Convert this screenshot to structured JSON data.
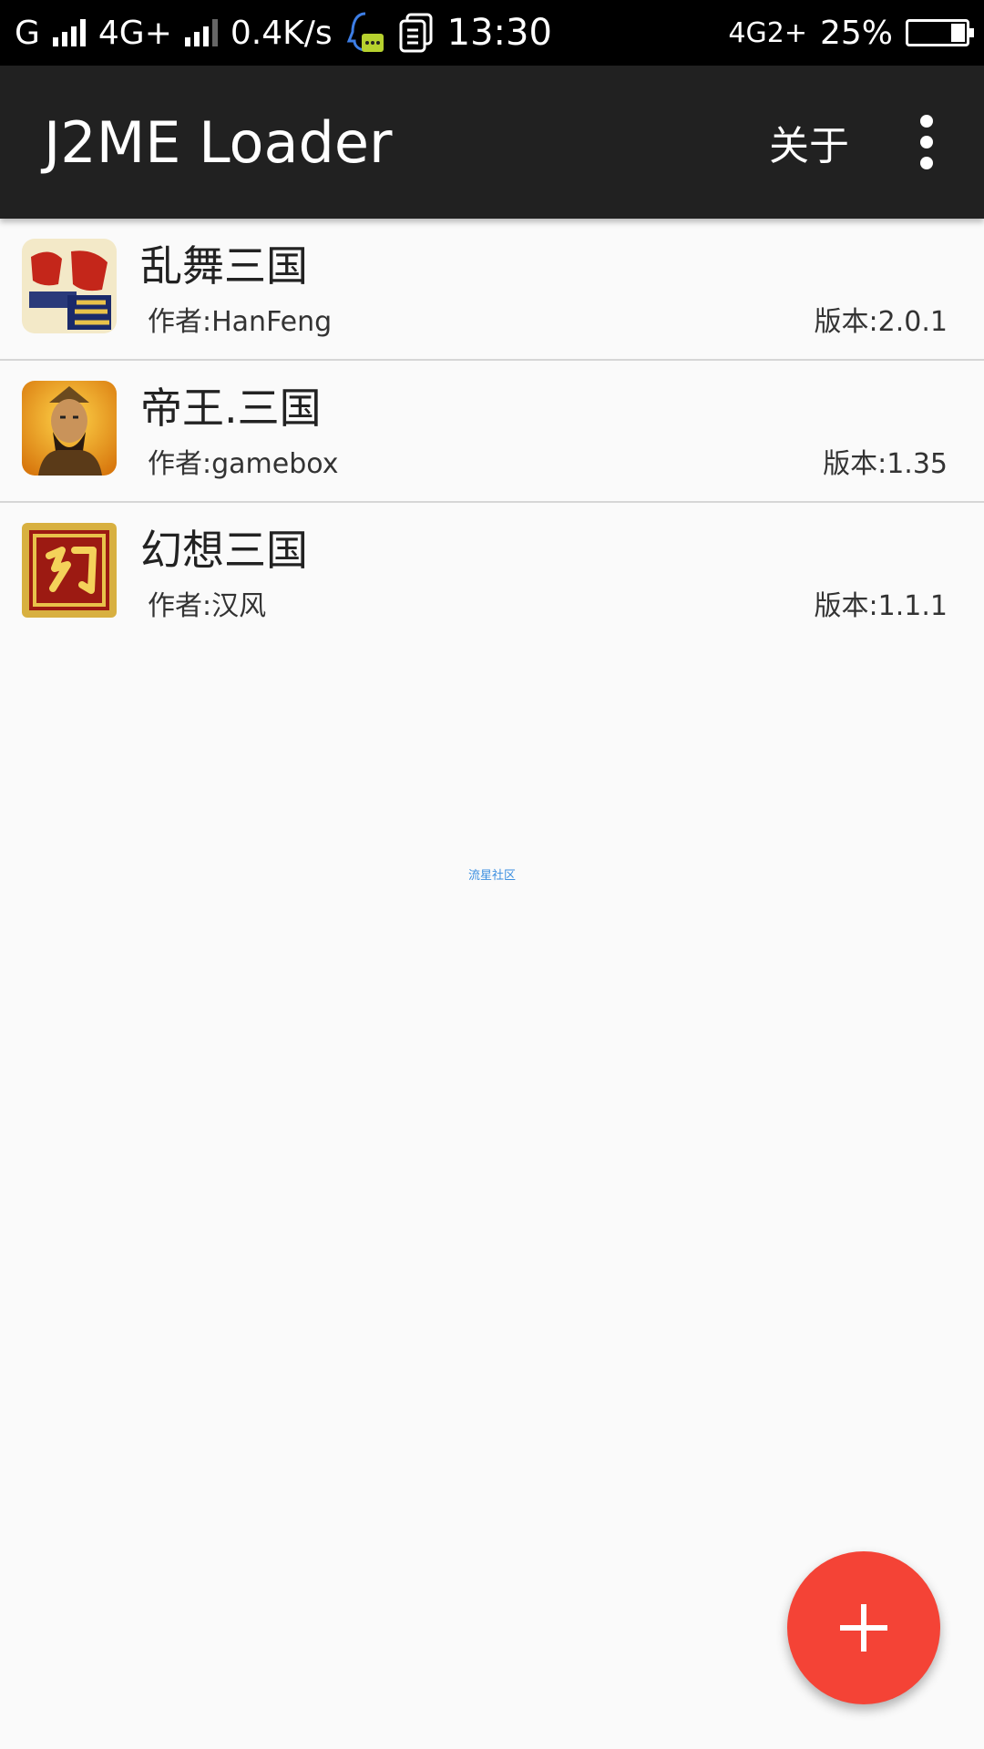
{
  "status_bar": {
    "carrier": "G",
    "network": "4G+",
    "speed": "0.4K/s",
    "time": "13:30",
    "network2": "4G2+",
    "battery": "25%",
    "battery_level": 0.25
  },
  "app_bar": {
    "title": "J2ME Loader",
    "about": "关于",
    "overflow_icon": "more-vert-icon"
  },
  "apps": [
    {
      "name": "乱舞三国",
      "author": "作者:HanFeng",
      "version": "版本:2.0.1",
      "icon": "luanwu-sanguo-icon"
    },
    {
      "name": "帝王.三国",
      "author": "作者:gamebox",
      "version": "版本:1.35",
      "icon": "diwang-sanguo-icon"
    },
    {
      "name": "幻想三国",
      "author": "作者:汉风",
      "version": "版本:1.1.1",
      "icon": "huanxiang-sanguo-icon"
    }
  ],
  "watermark": "流星社区",
  "fab": {
    "icon": "add-icon",
    "color": "#f44336"
  }
}
